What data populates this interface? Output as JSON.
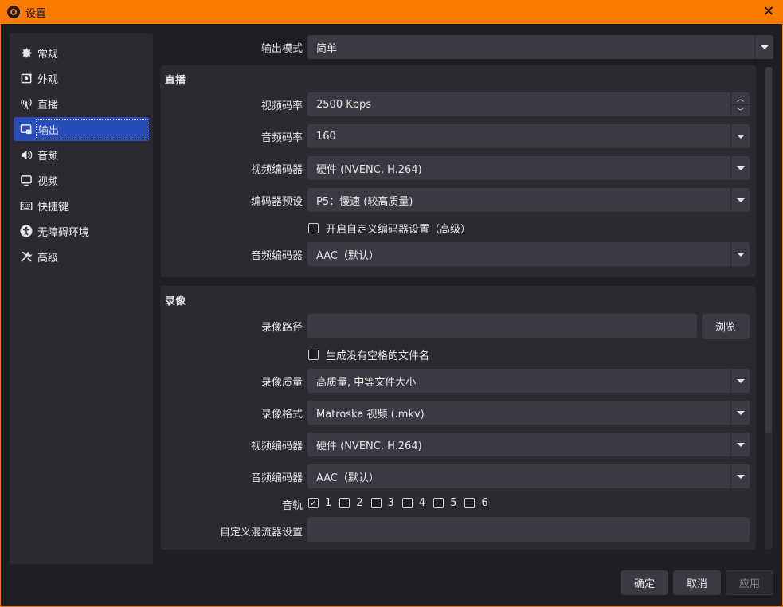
{
  "window": {
    "title": "设置"
  },
  "sidebar": {
    "items": [
      {
        "label": "常规",
        "icon": "gear-icon"
      },
      {
        "label": "外观",
        "icon": "appearance-icon"
      },
      {
        "label": "直播",
        "icon": "antenna-icon"
      },
      {
        "label": "输出",
        "icon": "output-icon",
        "active": true
      },
      {
        "label": "音频",
        "icon": "speaker-icon"
      },
      {
        "label": "视频",
        "icon": "monitor-icon"
      },
      {
        "label": "快捷键",
        "icon": "keyboard-icon"
      },
      {
        "label": "无障碍环境",
        "icon": "accessibility-icon"
      },
      {
        "label": "高级",
        "icon": "tools-icon"
      }
    ]
  },
  "output_mode": {
    "label": "输出模式",
    "value": "简单"
  },
  "streaming": {
    "title": "直播",
    "video_bitrate": {
      "label": "视频码率",
      "value": "2500 Kbps"
    },
    "audio_bitrate": {
      "label": "音频码率",
      "value": "160"
    },
    "video_encoder": {
      "label": "视频编码器",
      "value": "硬件 (NVENC, H.264)"
    },
    "encoder_preset": {
      "label": "编码器预设",
      "value": "P5：慢速 (较高质量)"
    },
    "custom_encoder": {
      "label": "开启自定义编码器设置（高级）",
      "checked": false
    },
    "audio_encoder": {
      "label": "音频编码器",
      "value": "AAC（默认）"
    }
  },
  "recording": {
    "title": "录像",
    "path": {
      "label": "录像路径",
      "value": "",
      "browse": "浏览"
    },
    "no_space": {
      "label": "生成没有空格的文件名",
      "checked": false
    },
    "quality": {
      "label": "录像质量",
      "value": "高质量, 中等文件大小"
    },
    "format": {
      "label": "录像格式",
      "value": "Matroska 视频 (.mkv)"
    },
    "video_encoder": {
      "label": "视频编码器",
      "value": "硬件 (NVENC, H.264)"
    },
    "audio_encoder": {
      "label": "音频编码器",
      "value": "AAC（默认）"
    },
    "tracks": {
      "label": "音轨",
      "items": [
        {
          "num": "1",
          "checked": true
        },
        {
          "num": "2",
          "checked": false
        },
        {
          "num": "3",
          "checked": false
        },
        {
          "num": "4",
          "checked": false
        },
        {
          "num": "5",
          "checked": false
        },
        {
          "num": "6",
          "checked": false
        }
      ]
    },
    "muxer": {
      "label": "自定义混流器设置",
      "value": ""
    }
  },
  "footer": {
    "ok": "确定",
    "cancel": "取消",
    "apply": "应用"
  },
  "colors": {
    "accent": "#fd7a01",
    "selected": "#284cb8",
    "background": "#1f1e23",
    "panel": "#2b2a31",
    "control": "#3b3a42"
  }
}
